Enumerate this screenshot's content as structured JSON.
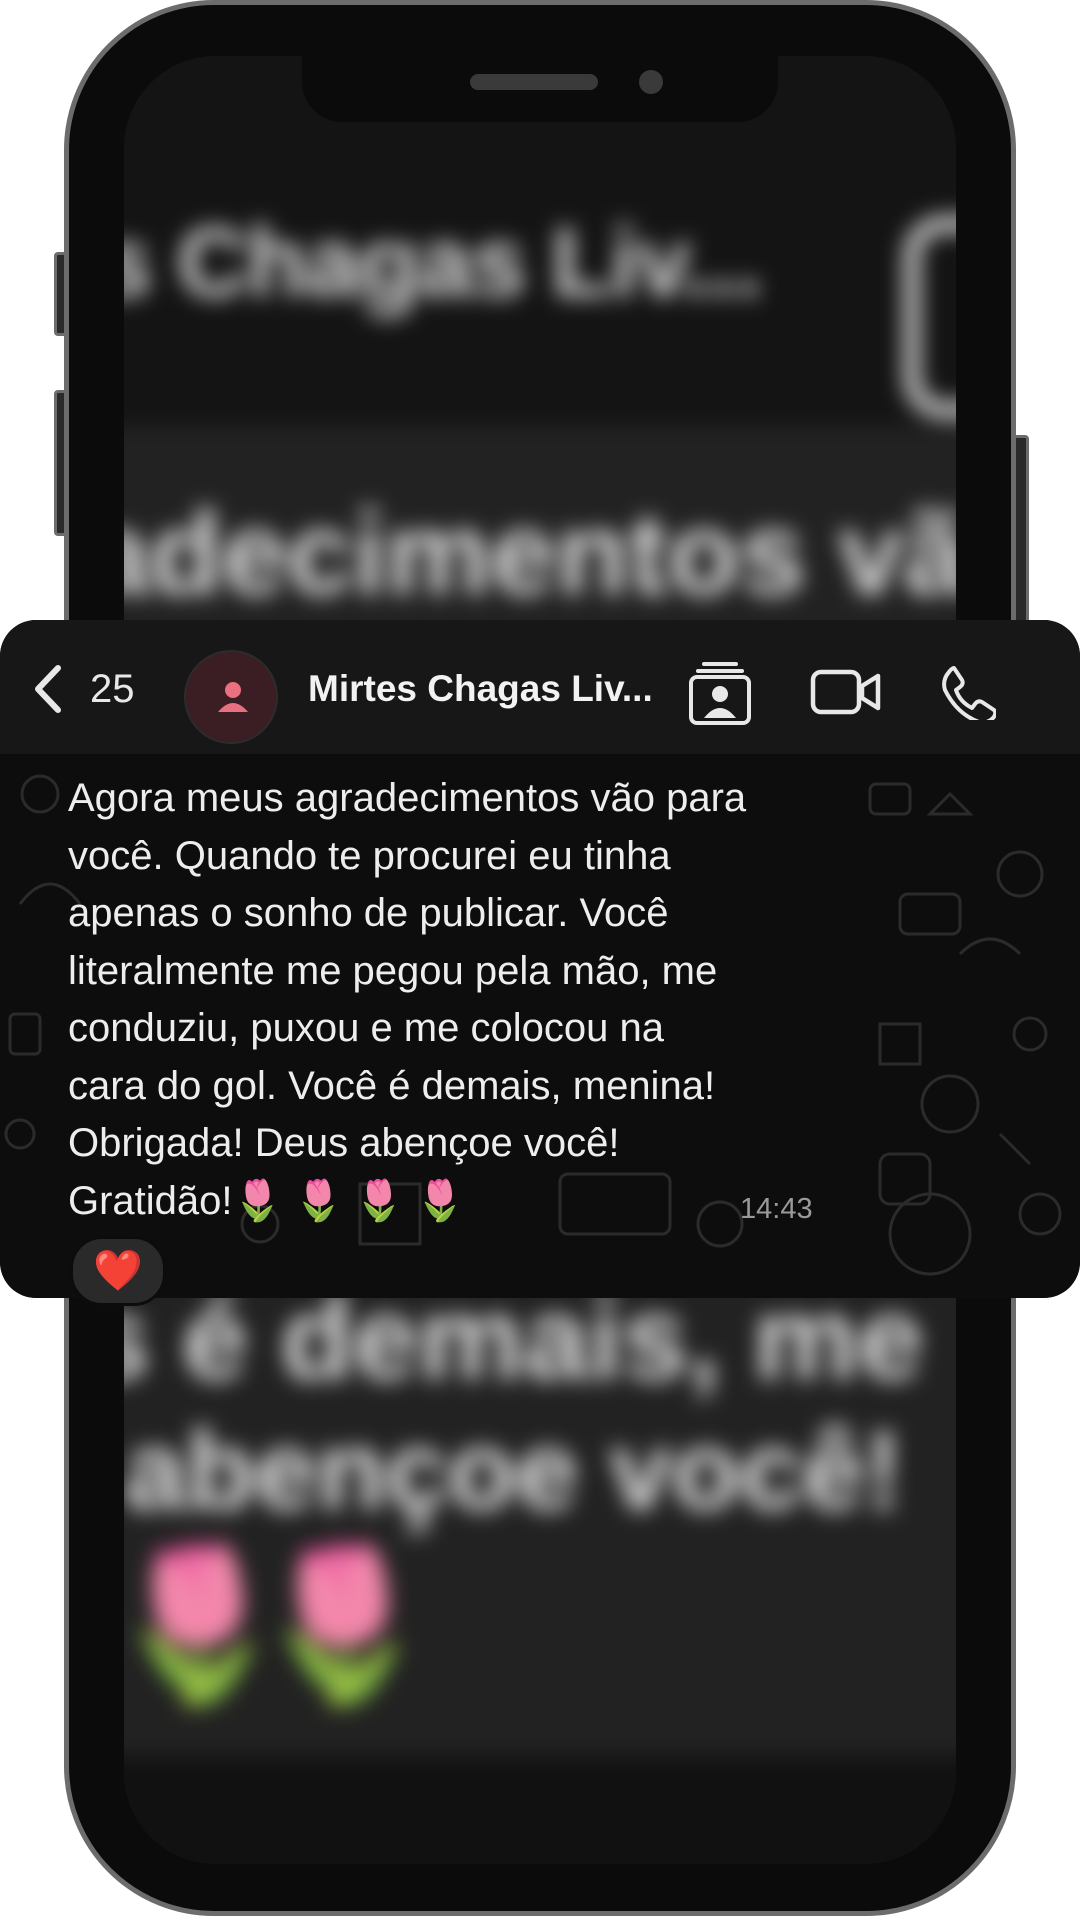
{
  "background": {
    "blurred_name": "es Chagas Liv...",
    "blurred_line1": "adecimentos vã",
    "blurred_line2": "s é demais, me",
    "blurred_line3": "abençoe você!"
  },
  "header": {
    "unread_count": "25",
    "contact_name": "Mirtes Chagas Liv...",
    "icons": [
      "back-chevron-icon",
      "avatar-person-icon",
      "contact-card-icon",
      "video-camera-icon",
      "phone-icon"
    ]
  },
  "message": {
    "text": "Agora meus agradecimentos vão para\nvocê. Quando te procurei eu tinha\napenas o sonho de publicar. Você\nliteralmente me pegou pela mão, me\nconduziu, puxou e me colocou na\ncara do gol. Você é demais, menina!\nObrigada! Deus abençoe você!\nGratidão!🌷 🌷 🌷 🌷",
    "time": "14:43",
    "reaction": "❤️"
  },
  "colors": {
    "header_bg": "#171717",
    "bubble_bg": "#232323",
    "avatar_bg": "#3b1d24",
    "avatar_icon": "#e8707f"
  }
}
